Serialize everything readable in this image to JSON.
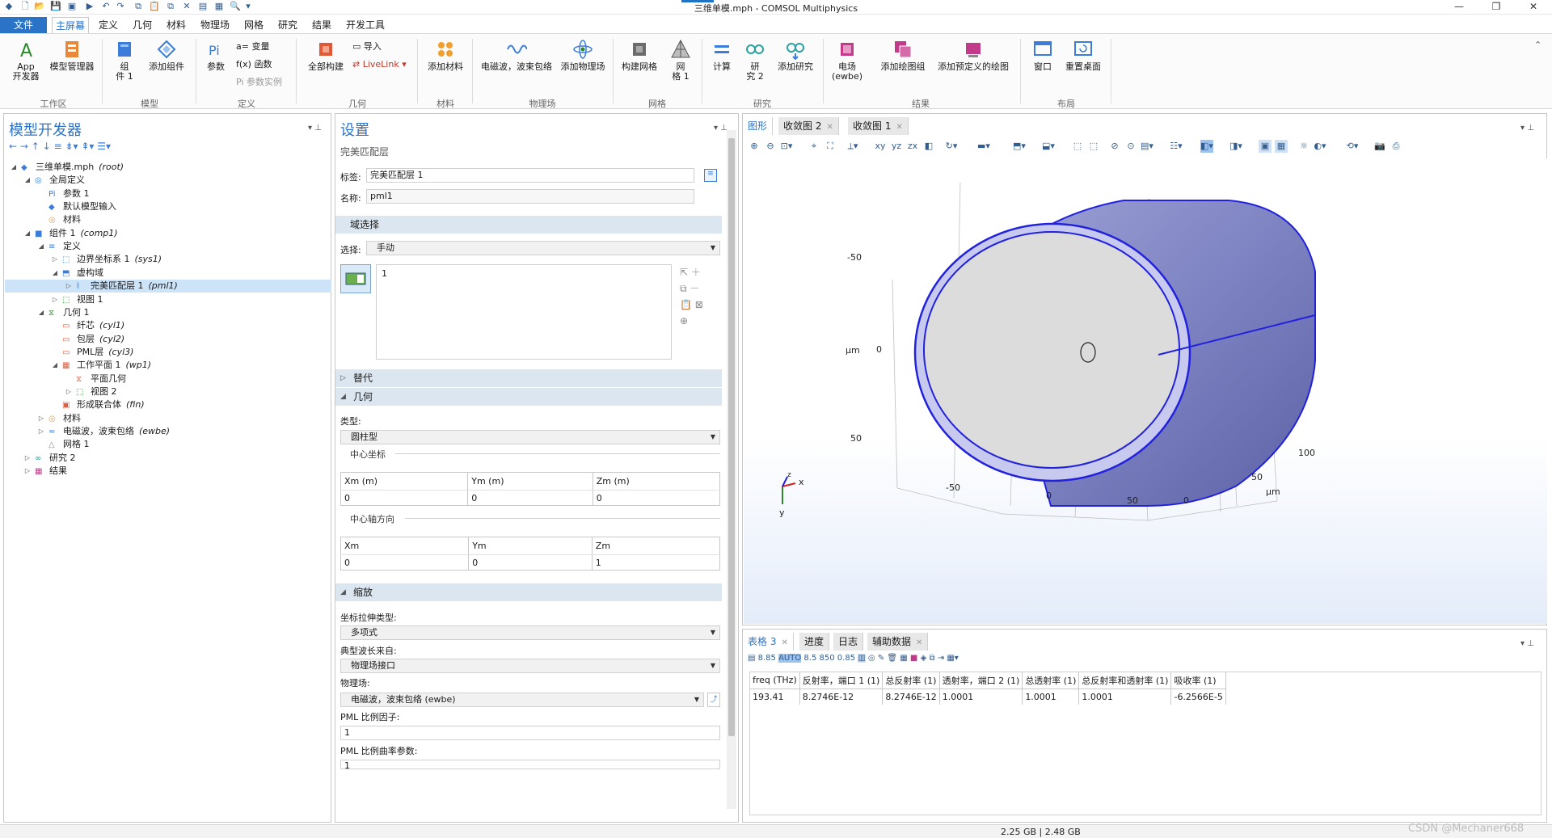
{
  "window": {
    "title": "三维单模.mph - COMSOL Multiphysics"
  },
  "menu": {
    "file": "文件",
    "tabs": [
      "主屏幕",
      "定义",
      "几何",
      "材料",
      "物理场",
      "网格",
      "研究",
      "结果",
      "开发工具"
    ]
  },
  "ribbon": {
    "app_builder": "App\n开发器",
    "model_manager": "模型管理器",
    "component": "组\n件 1",
    "add_component": "添加组件",
    "parameters": "参数",
    "variables": "a= 变量",
    "functions": "f(x) 函数",
    "param_instance": "参数实例",
    "build_all": "全部构建",
    "import": "导入",
    "livelink": "LiveLink",
    "add_material": "添加材料",
    "physics_ewbe": "电磁波，波束包络",
    "add_physics": "添加物理场",
    "build_mesh": "构建网格",
    "mesh1": "网\n格 1",
    "compute": "计算",
    "study2": "研\n究 2",
    "add_study": "添加研究",
    "em_field": "电场\n(ewbe)",
    "add_plot_group": "添加绘图组",
    "add_predefined_plot": "添加预定义的绘图",
    "window": "窗口",
    "reset_desktop": "重置桌面",
    "groups": {
      "workspace": "工作区",
      "model": "模型",
      "definitions": "定义",
      "geometry": "几何",
      "materials": "材料",
      "physics": "物理场",
      "mesh": "网格",
      "study": "研究",
      "results": "结果",
      "layout": "布局"
    }
  },
  "model_builder": {
    "title": "模型开发器",
    "tree": [
      {
        "label": "三维单模.mph",
        "tag": "(root)"
      },
      {
        "label": "全局定义",
        "tag": ""
      },
      {
        "label": "参数 1",
        "tag": ""
      },
      {
        "label": "默认模型输入",
        "tag": ""
      },
      {
        "label": "材料",
        "tag": ""
      },
      {
        "label": "组件 1",
        "tag": "(comp1)"
      },
      {
        "label": "定义",
        "tag": ""
      },
      {
        "label": "边界坐标系 1",
        "tag": "(sys1)"
      },
      {
        "label": "虚构域",
        "tag": ""
      },
      {
        "label": "完美匹配层 1",
        "tag": "(pml1)"
      },
      {
        "label": "视图 1",
        "tag": ""
      },
      {
        "label": "几何 1",
        "tag": ""
      },
      {
        "label": "纤芯",
        "tag": "(cyl1)"
      },
      {
        "label": "包层",
        "tag": "(cyl2)"
      },
      {
        "label": "PML层",
        "tag": "(cyl3)"
      },
      {
        "label": "工作平面 1",
        "tag": "(wp1)"
      },
      {
        "label": "平面几何",
        "tag": ""
      },
      {
        "label": "视图 2",
        "tag": ""
      },
      {
        "label": "形成联合体",
        "tag": "(fin)"
      },
      {
        "label": "材料",
        "tag": ""
      },
      {
        "label": "电磁波，波束包络",
        "tag": "(ewbe)"
      },
      {
        "label": "网格 1",
        "tag": ""
      },
      {
        "label": "研究 2",
        "tag": ""
      },
      {
        "label": "结果",
        "tag": ""
      }
    ]
  },
  "settings": {
    "title": "设置",
    "subtitle": "完美匹配层",
    "label_field": "标签:",
    "label_value": "完美匹配层 1",
    "name_field": "名称:",
    "name_value": "pml1",
    "domain_selection": "域选择",
    "selection_label": "选择:",
    "selection_value": "手动",
    "selection_item": "1",
    "override": "替代",
    "geometry": "几何",
    "type_label": "类型:",
    "type_value": "圆柱型",
    "center_coord": "中心坐标",
    "center_headers": [
      "Xm (m)",
      "Ym (m)",
      "Zm (m)"
    ],
    "center_values": [
      "0",
      "0",
      "0"
    ],
    "axis_dir": "中心轴方向",
    "axis_headers": [
      "Xm",
      "Ym",
      "Zm"
    ],
    "axis_values": [
      "0",
      "0",
      "1"
    ],
    "scaling": "缩放",
    "stretch_type_label": "坐标拉伸类型:",
    "stretch_type_value": "多项式",
    "wavelength_label": "典型波长来自:",
    "wavelength_value": "物理场接口",
    "physics_label": "物理场:",
    "physics_value": "电磁波，波束包络 (ewbe)",
    "scale_factor_label": "PML 比例因子:",
    "scale_factor_value": "1",
    "curvature_label": "PML 比例曲率参数:",
    "curvature_value": "1"
  },
  "graphics": {
    "tabs": [
      "图形",
      "收敛图 2",
      "收敛图 1"
    ],
    "axis_labels": {
      "y_top": "-50",
      "y_zero": "0",
      "y_bottom": "50",
      "unit_left": "μm",
      "x_neg": "-50",
      "x_zero": "0",
      "x_fifty": "50",
      "z_zero": "0",
      "z_fifty": "50",
      "z_hundred": "100",
      "unit_right": "μm",
      "triad_x": "x",
      "triad_y": "y",
      "triad_z": "z"
    },
    "colors": {
      "cylinder_side": "#7d82c2",
      "cylinder_edge": "#2222dd",
      "cylinder_face": "#dcdcdc"
    }
  },
  "bottom": {
    "tabs": [
      "表格 3",
      "进度",
      "日志",
      "辅助数据"
    ],
    "table_headers": [
      "freq (THz)",
      "反射率，端口 1 (1)",
      "总反射率 (1)",
      "透射率，端口 2 (1)",
      "总透射率 (1)",
      "总反射率和透射率 (1)",
      "吸收率 (1)"
    ],
    "table_rows": [
      [
        "193.41",
        "8.2746E-12",
        "8.2746E-12",
        "1.0001",
        "1.0001",
        "1.0001",
        "-6.2566E-5"
      ]
    ]
  },
  "status": {
    "memory": "2.25 GB | 2.48 GB",
    "watermark": "CSDN @Mechaner668"
  }
}
